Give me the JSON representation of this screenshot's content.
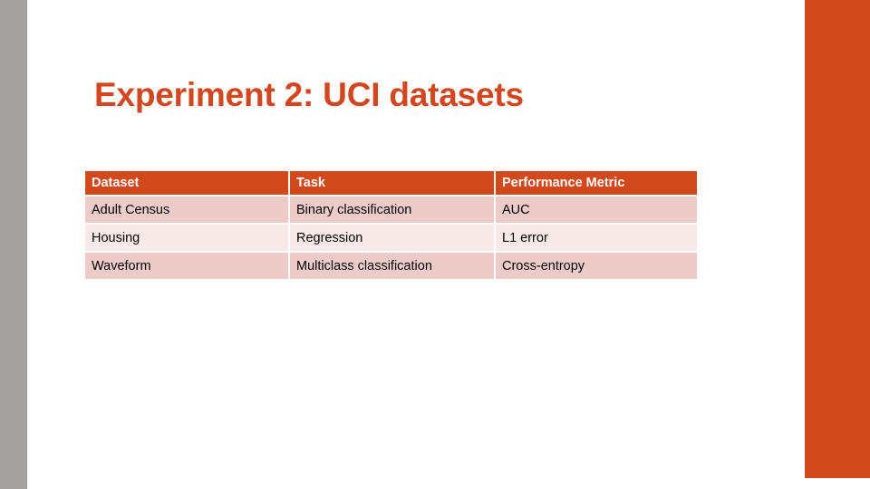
{
  "slide": {
    "title": "Experiment 2: UCI datasets",
    "accent_color": "#d2491c",
    "title_color": "#d2471f",
    "left_bar_color": "#a3a09f",
    "background_color": "#ffffff",
    "row_shade_dark": "#edcbc9",
    "row_shade_light": "#f6e9e7"
  },
  "table": {
    "columns": [
      "Dataset",
      "Task",
      "Performance Metric"
    ],
    "rows": [
      [
        "Adult Census",
        "Binary classification",
        "AUC"
      ],
      [
        "Housing",
        "Regression",
        "L1 error"
      ],
      [
        "Waveform",
        "Multiclass classification",
        "Cross-entropy"
      ]
    ]
  }
}
